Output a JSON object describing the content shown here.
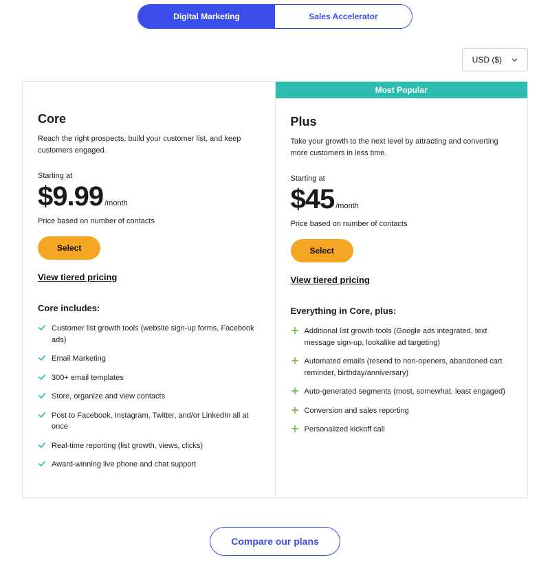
{
  "tabs": {
    "digital": "Digital Marketing",
    "sales": "Sales Accelerator"
  },
  "currency": {
    "selected": "USD ($)"
  },
  "plans": {
    "core": {
      "name": "Core",
      "desc": "Reach the right prospects, build your customer list, and keep customers engaged.",
      "starting_label": "Starting at",
      "price": "$9.99",
      "per": "/month",
      "price_note": "Price based on number of contacts",
      "select_label": "Select",
      "tiered_label": "View tiered pricing",
      "section_heading": "Core includes:",
      "features": [
        "Customer list growth tools (website sign-up forms, Facebook ads)",
        "Email Marketing",
        "300+ email templates",
        "Store, organize and view contacts",
        "Post to Facebook, Instagram, Twitter, and/or LinkedIn all at once",
        "Real-time reporting (list growth, views, clicks)",
        "Award-winning live phone and chat support"
      ]
    },
    "plus": {
      "badge": "Most Popular",
      "name": "Plus",
      "desc": "Take your growth to the next level by attracting and converting more customers in less time.",
      "starting_label": "Starting at",
      "price": "$45",
      "per": "/month",
      "price_note": "Price based on number of contacts",
      "select_label": "Select",
      "tiered_label": "View tiered pricing",
      "section_heading": "Everything in Core, plus:",
      "features": [
        "Additional list growth tools (Google ads integrated, text message sign-up, lookalike ad targeting)",
        "Automated emails (resend to non-openers, abandoned cart reminder, birthday/anniversary)",
        "Auto-generated segments (most, somewhat, least engaged)",
        "Conversion and sales reporting",
        " Personalized kickoff call"
      ]
    }
  },
  "compare": {
    "label": "Compare our plans"
  },
  "colors": {
    "primary": "#3a4de8",
    "accent": "#f5a623",
    "badge": "#2cbdb0",
    "check": "#2cbdb0",
    "plus": "#6fbf4a"
  }
}
